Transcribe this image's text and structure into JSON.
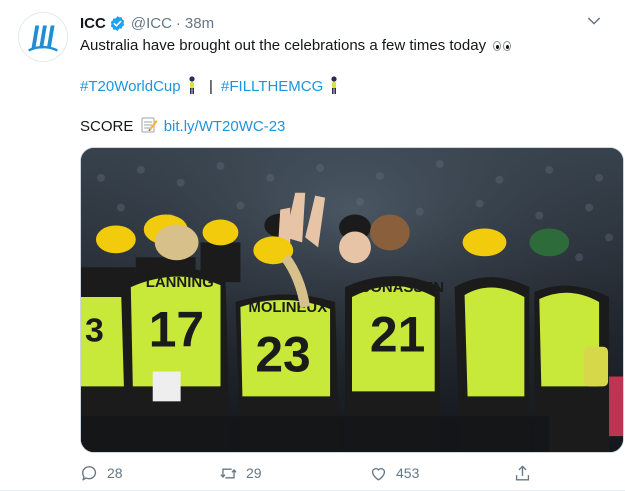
{
  "tweet": {
    "author": {
      "name": "ICC",
      "handle": "@ICC",
      "verified": true,
      "avatar_icon": "icc-logo-icon"
    },
    "time_separator": "·",
    "time": "38m",
    "lines": {
      "text": "Australia have brought out the celebrations a few times today",
      "text_emoji": "eyes-emoji",
      "hashtag_1": "#T20WorldCup",
      "hashtag_1_emoji": "cricket-player-emoji",
      "separator": "|",
      "hashtag_2": "#FILLTHEMCG",
      "hashtag_2_emoji": "cricket-player-emoji",
      "score_label": "SCORE",
      "score_emoji": "memo-emoji",
      "score_link": "bit.ly/WT20WC-23"
    },
    "media": {
      "type": "photo",
      "player_names": [
        "LANNING",
        "MOLINEUX",
        "JONASSEN"
      ],
      "player_numbers": [
        "17",
        "23",
        "21"
      ],
      "kit_colors": {
        "jersey": "#c8e83a",
        "shoulder": "#1b1b1b",
        "helmet": "#f2cc0c",
        "background": "#2b3038"
      }
    },
    "actions": {
      "reply_count": "28",
      "retweet_count": "29",
      "like_count": "453"
    },
    "colors": {
      "link": "#1b95e0",
      "secondary_text": "#657786",
      "verified_badge": "#1da1f2"
    }
  }
}
